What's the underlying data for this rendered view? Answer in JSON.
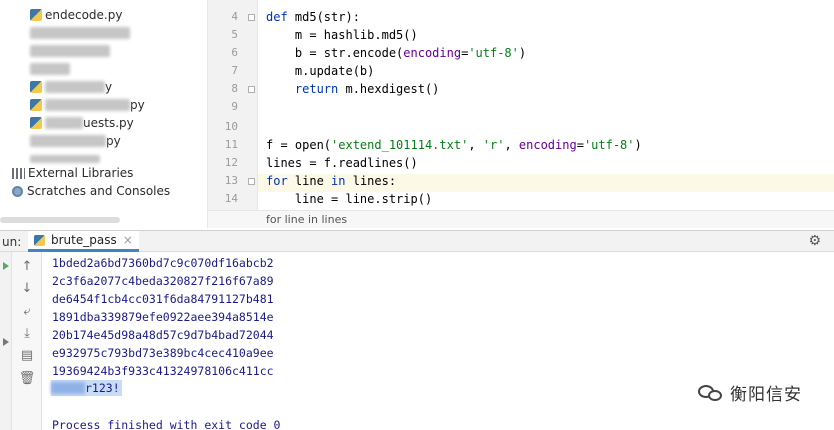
{
  "project_tree": {
    "items": [
      {
        "label": "endecode.py",
        "blurred": false
      },
      {
        "label": "",
        "blurred": true
      },
      {
        "label": "",
        "blurred": true
      },
      {
        "label": "",
        "blurred": true
      },
      {
        "label": "y",
        "blurred": true
      },
      {
        "label": "py",
        "blurred": true
      },
      {
        "label": "uests.py",
        "blurred": true
      },
      {
        "label": "py",
        "blurred": true
      },
      {
        "label": "",
        "blurred": true
      }
    ],
    "external_libraries": "External Libraries",
    "scratches": "Scratches and Consoles"
  },
  "editor": {
    "line_numbers": [
      "4",
      "5",
      "6",
      "7",
      "8",
      "9",
      "10",
      "11",
      "12",
      "13",
      "14"
    ],
    "code": {
      "l4_kw": "def",
      "l4_rest": " md5(str):",
      "l5": "    m = hashlib.md5()",
      "l6_a": "    b = str.encode(",
      "l6_param": "encoding",
      "l6_b": "=",
      "l6_str": "'utf-8'",
      "l6_c": ")",
      "l7": "    m.update(b)",
      "l8_kw": "    return",
      "l8_rest": " m.hexdigest()",
      "l11_a": "f = open(",
      "l11_s1": "'extend_101114.txt'",
      "l11_b": ", ",
      "l11_s2": "'r'",
      "l11_c": ", ",
      "l11_param": "encoding",
      "l11_d": "=",
      "l11_s3": "'utf-8'",
      "l11_e": ")",
      "l12": "lines = f.readlines()",
      "l13_kw1": "for",
      "l13_a": " line ",
      "l13_kw2": "in",
      "l13_b": " lines:",
      "l14": "    line = line.strip()"
    },
    "breadcrumb": "for line in lines"
  },
  "run": {
    "label": "un:",
    "tab_label": "brute_pass",
    "tab_close": "×",
    "gear": "⚙",
    "output": [
      "1bded2a6bd7360bd7c9c070df16abcb2",
      "2c3f6a2077c4beda320827f216f67a89",
      "de6454f1cb4cc031f6da84791127b481",
      "1891dba339879efe0922aee394a8514e",
      "20b174e45d98a48d57c9d7b4bad72044",
      "e932975c793bd73e389bc4cec410a9ee",
      "19369424b3f933c41324978106c411cc"
    ],
    "password_visible": "r123!",
    "exit_message": "Process finished with exit code 0"
  },
  "watermark": {
    "text": "衡阳信安"
  },
  "colors": {
    "keyword": "#0033b3",
    "string": "#067d17",
    "param": "#660099",
    "console_text": "#1a1a8c",
    "tab_underline": "#4083c9"
  }
}
